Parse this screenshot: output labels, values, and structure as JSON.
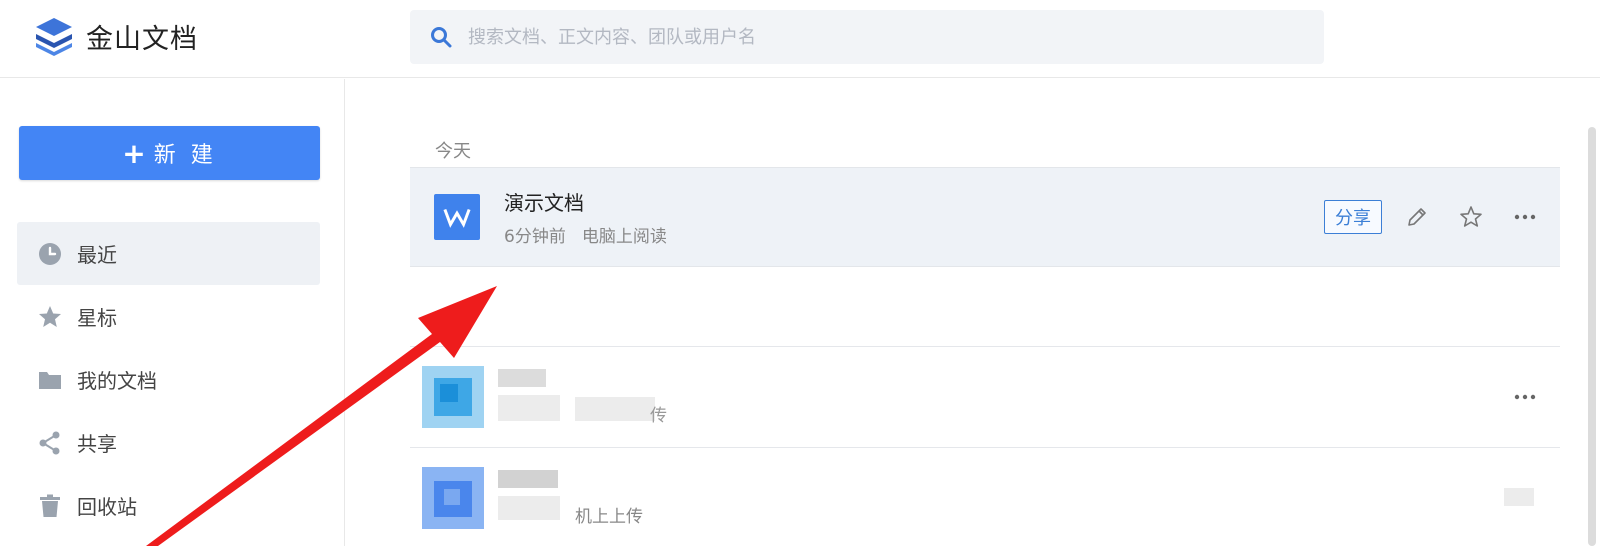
{
  "app": {
    "logo_text": "金山文档"
  },
  "search": {
    "placeholder": "搜索文档、正文内容、团队或用户名"
  },
  "sidebar": {
    "new_button": {
      "icon": "plus",
      "label": "新 建"
    },
    "items": [
      {
        "label": "最近",
        "icon": "clock-icon",
        "active": true
      },
      {
        "label": "星标",
        "icon": "star-icon",
        "active": false
      },
      {
        "label": "我的文档",
        "icon": "folder-icon",
        "active": false
      },
      {
        "label": "共享",
        "icon": "share-icon",
        "active": false
      },
      {
        "label": "回收站",
        "icon": "trash-icon",
        "active": false
      }
    ]
  },
  "main": {
    "section_title": "今天",
    "files": [
      {
        "name": "演示文档",
        "time": "6分钟前",
        "source": "电脑上阅读",
        "icon": "word-doc-icon",
        "icon_letter": "W",
        "share_label": "分享",
        "selected": true
      },
      {
        "name": "",
        "time": "",
        "source": "传",
        "icon": "blurred-thumbnail-icon",
        "selected": false
      },
      {
        "name": "",
        "time": "",
        "source": "机上上传",
        "icon": "blurred-thumbnail-icon",
        "selected": false
      }
    ]
  },
  "colors": {
    "accent": "#4385f5",
    "annotation_arrow": "#ee1c1c"
  }
}
